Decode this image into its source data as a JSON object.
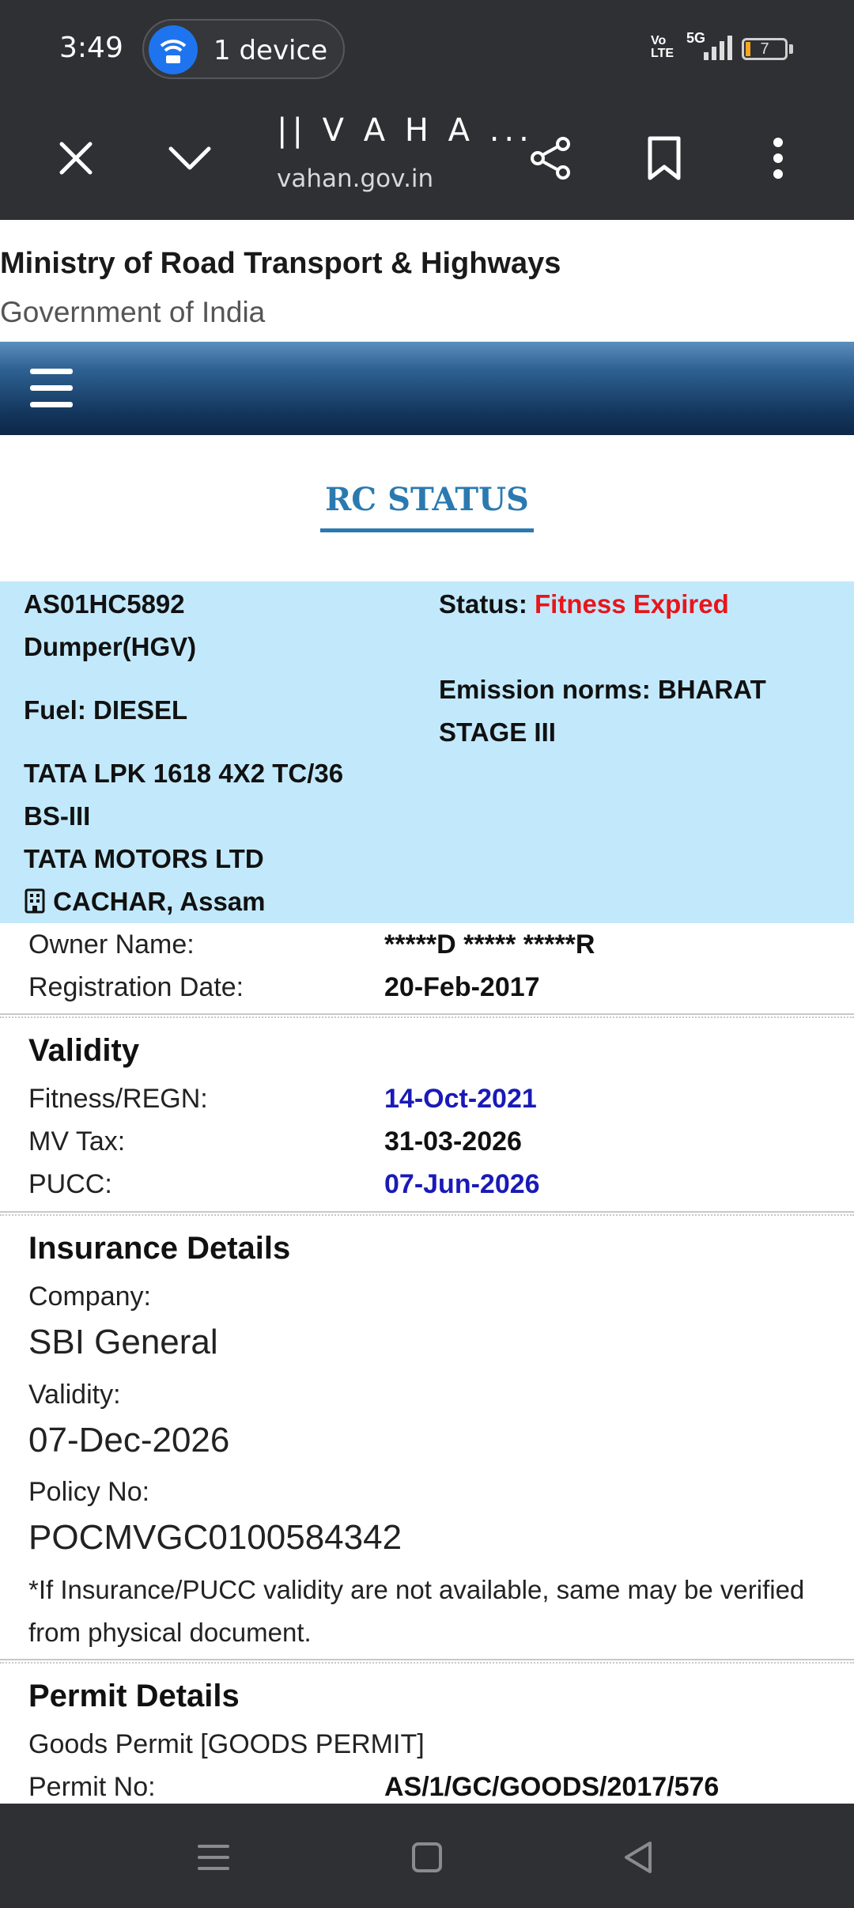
{
  "status_bar": {
    "time": "3:49",
    "hotspot_label": "1 device",
    "volte": "Vo LTE",
    "network": "5G",
    "battery": "7"
  },
  "toolbar": {
    "title": "|| V A H A ...",
    "url": "vahan.gov.in"
  },
  "header": {
    "ministry": "Ministry of Road Transport & Highways",
    "government": "Government of India"
  },
  "page_title": "RC STATUS",
  "summary": {
    "reg_number": "AS01HC5892",
    "vehicle_class": "Dumper(HGV)",
    "fuel": "Fuel: DIESEL",
    "model_line1": "TATA LPK 1618 4X2 TC/36",
    "model_line2": "BS-III",
    "maker": "TATA MOTORS LTD",
    "location": "CACHAR, Assam",
    "status_label": "Status:",
    "status_value": "Fitness Expired",
    "emission_line1": "Emission norms: BHARAT",
    "emission_line2": "STAGE III"
  },
  "owner": {
    "owner_label": "Owner Name:",
    "owner_value": "*****D ***** *****R",
    "reg_date_label": "Registration Date:",
    "reg_date_value": "20-Feb-2017"
  },
  "validity": {
    "title": "Validity",
    "fitness_label": "Fitness/REGN:",
    "fitness_value": "14-Oct-2021",
    "tax_label": "MV Tax:",
    "tax_value": "31-03-2026",
    "pucc_label": "PUCC:",
    "pucc_value": "07-Jun-2026"
  },
  "insurance": {
    "title": "Insurance Details",
    "company_label": "Company:",
    "company_value": "SBI General",
    "validity_label": "Validity:",
    "validity_value": "07-Dec-2026",
    "policy_label": "Policy No:",
    "policy_value": "POCMVGC0100584342",
    "note": "*If Insurance/PUCC validity are not available, same may be verified from physical document."
  },
  "permit": {
    "title": "Permit Details",
    "type": "Goods Permit [GOODS PERMIT]",
    "permit_no_label": "Permit No:",
    "permit_no_value": "AS/1/GC/GOODS/2017/576"
  },
  "colors": {
    "status_red": "#e8151b",
    "date_blue": "#1a1ab8",
    "summary_bg": "#c2e9fb",
    "title_blue": "#2a7ab0"
  }
}
